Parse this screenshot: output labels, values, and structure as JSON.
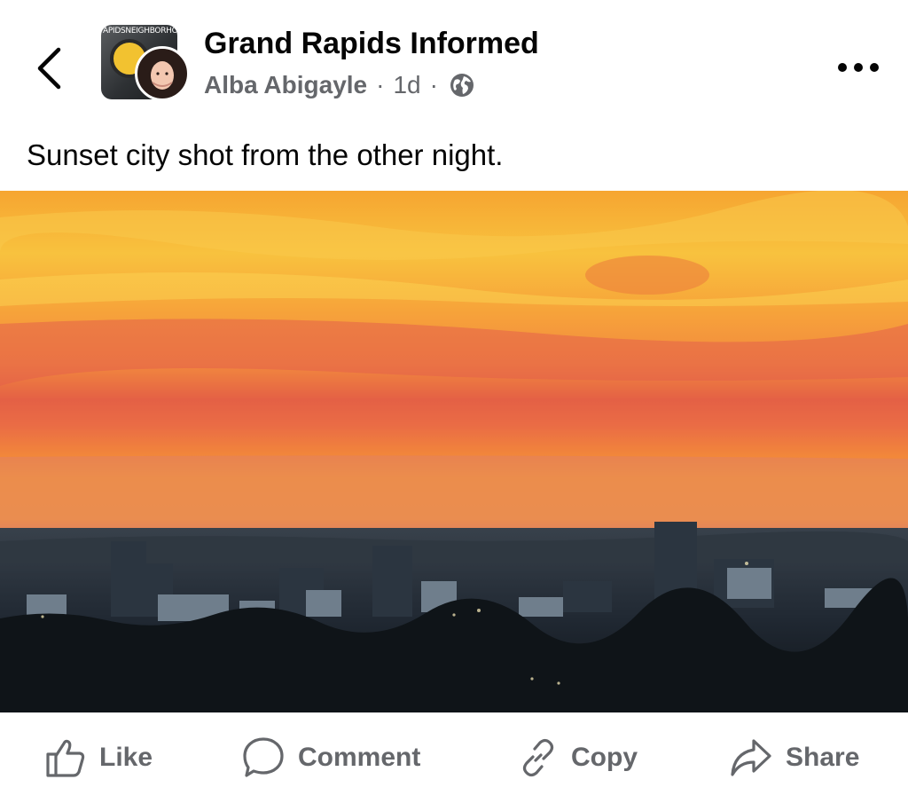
{
  "post": {
    "group_name": "Grand Rapids Informed",
    "author": "Alba Abigayle",
    "time": "1d",
    "separator": "·",
    "privacy_icon": "globe-icon",
    "text": "Sunset city shot from the other night.",
    "group_avatar_text": "APIDSNEIGHBORHOO"
  },
  "header": {
    "back_icon": "chevron-left-icon",
    "more_icon": "more-horizontal-icon"
  },
  "actions": [
    {
      "label": "Like",
      "icon": "thumbs-up-icon"
    },
    {
      "label": "Comment",
      "icon": "comment-icon"
    },
    {
      "label": "Copy",
      "icon": "link-icon"
    },
    {
      "label": "Share",
      "icon": "share-icon"
    }
  ],
  "colors": {
    "text_primary": "#050505",
    "text_secondary": "#65676b",
    "sky_orange": "#f39a2e",
    "sky_red": "#e0604a",
    "city_dark": "#1e2630"
  }
}
